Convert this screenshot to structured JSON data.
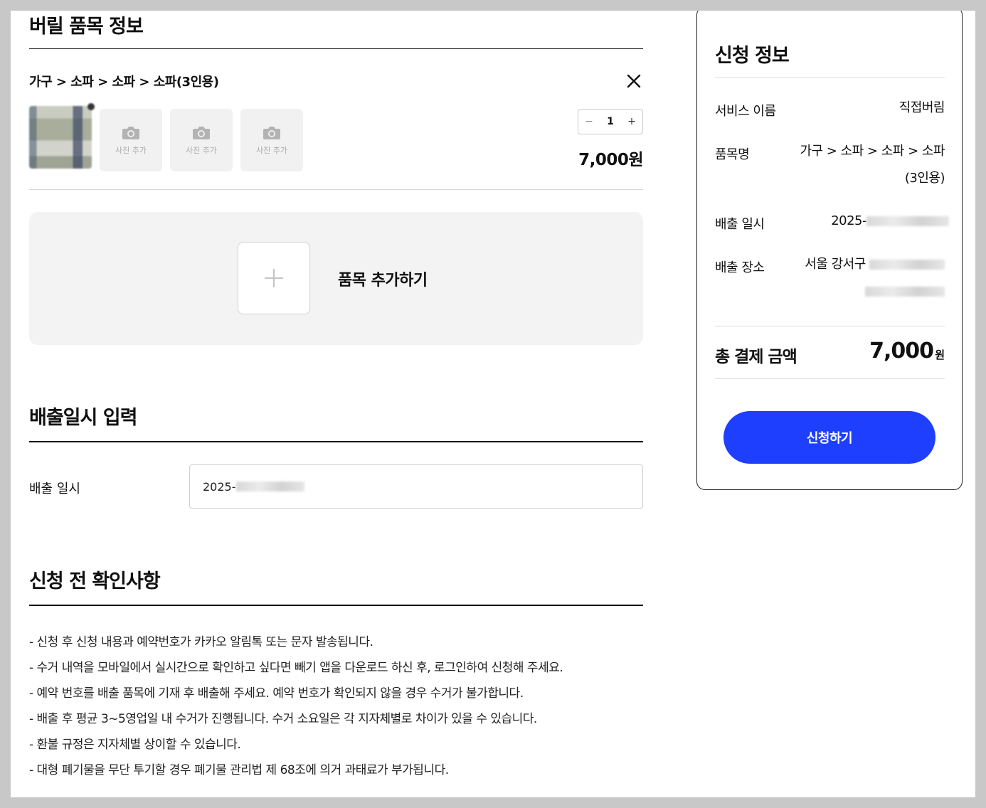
{
  "item_section": {
    "title": "버릴 품목 정보",
    "category_path": "가구 > 소파 > 소파 > 소파(3인용)",
    "close_icon": "close-icon",
    "photo_add_label": "사진 추가",
    "photo_add_icon": "camera-icon",
    "quantity": "1",
    "qty_minus": "−",
    "qty_plus": "+",
    "price": "7,000원",
    "add_item_label": "품목 추가하기",
    "add_item_icon": "plus-icon"
  },
  "date_section": {
    "title": "배출일시 입력",
    "field_label": "배출 일시",
    "field_value": "2025-"
  },
  "notice_section": {
    "title": "신청 전 확인사항",
    "items": [
      "- 신청 후 신청 내용과 예약번호가 카카오 알림톡 또는 문자 발송됩니다.",
      "- 수거 내역을 모바일에서 실시간으로 확인하고 싶다면 빼기 앱을 다운로드 하신 후, 로그인하여 신청해 주세요.",
      "- 예약 번호를 배출 품목에 기재 후 배출해 주세요. 예약 번호가 확인되지 않을 경우 수거가 불가합니다.",
      "- 배출 후 평균 3~5영업일 내 수거가 진행됩니다. 수거 소요일은 각 지자체별로 차이가 있을 수 있습니다.",
      "- 환불 규정은 지자체별 상이할 수 있습니다.",
      "- 대형 폐기물을 무단 투기할 경우 폐기물 관리법 제 68조에 의거 과태료가 부가됩니다."
    ]
  },
  "summary": {
    "title": "신청 정보",
    "service_label": "서비스 이름",
    "service_value": "직접버림",
    "item_label": "품목명",
    "item_value_line1": "가구 > 소파 > 소파 > 소파",
    "item_value_line2": "(3인용)",
    "date_label": "배출 일시",
    "date_value": "2025-",
    "place_label": "배출 장소",
    "place_value": "서울 강서구",
    "total_label": "총 결제 금액",
    "total_amount": "7,000",
    "total_unit": "원",
    "apply_label": "신청하기"
  },
  "colors": {
    "accent": "#1f3fff",
    "panel_bg": "#f3f3f3"
  }
}
